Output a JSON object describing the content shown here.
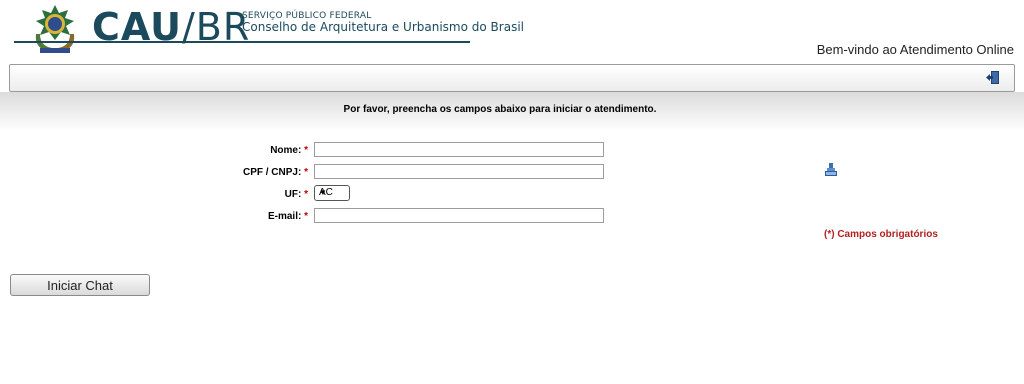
{
  "header": {
    "logo_main": "CAU",
    "logo_slash": "/",
    "logo_sub": "BR",
    "org_line1": "SERVIÇO PÚBLICO FEDERAL",
    "org_line2": "Conselho de Arquitetura e Urbanismo do Brasil",
    "welcome": "Bem-vindo ao Atendimento Online"
  },
  "toolbar": {
    "exit_icon": "exit-door-icon"
  },
  "instruction": "Por favor, preencha os campos abaixo para iniciar o atendimento.",
  "form": {
    "required_mark": "*",
    "name": {
      "label": "Nome:",
      "value": ""
    },
    "cpf": {
      "label": "CPF / CNPJ:",
      "value": ""
    },
    "uf": {
      "label": "UF:",
      "selected": "AC"
    },
    "email": {
      "label": "E-mail:",
      "value": ""
    },
    "keyboard_icon": "virtual-keyboard-icon",
    "required_note": "(*) Campos obrigatórios"
  },
  "actions": {
    "start_chat": "Iniciar Chat"
  },
  "colors": {
    "brand": "#1b4a5c",
    "required": "#c00000"
  }
}
